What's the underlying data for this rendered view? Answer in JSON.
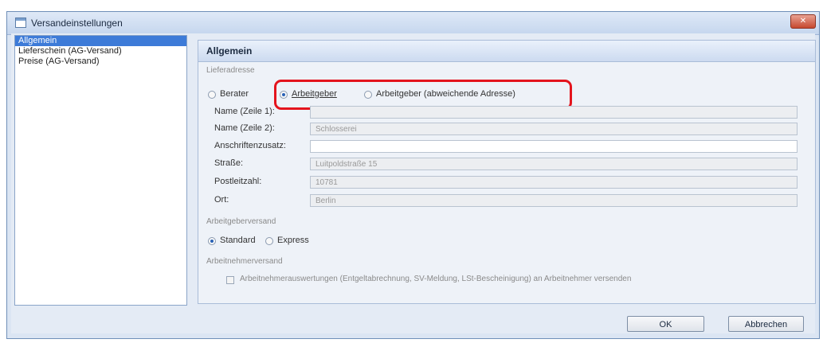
{
  "window": {
    "title": "Versandeinstellungen",
    "close_label": "✕"
  },
  "nav": {
    "items": [
      {
        "label": "Allgemein",
        "selected": true
      },
      {
        "label": "Lieferschein (AG-Versand)",
        "selected": false
      },
      {
        "label": "Preise (AG-Versand)",
        "selected": false
      }
    ]
  },
  "panel": {
    "title": "Allgemein",
    "lieferadresse": {
      "group_title": "Lieferadresse",
      "options": [
        {
          "label": "Berater",
          "checked": false
        },
        {
          "label": "Arbeitgeber",
          "checked": true
        },
        {
          "label": "Arbeitgeber (abweichende Adresse)",
          "checked": false
        }
      ]
    },
    "fields": [
      {
        "label": "Name (Zeile 1):",
        "value": ""
      },
      {
        "label": "Name (Zeile 2):",
        "value": "Schlosserei"
      },
      {
        "label": "Anschriftenzusatz:",
        "value": ""
      },
      {
        "label": "Straße:",
        "value": "Luitpoldstraße 15"
      },
      {
        "label": "Postleitzahl:",
        "value": "10781"
      },
      {
        "label": "Ort:",
        "value": "Berlin"
      }
    ],
    "arbeitgeberversand": {
      "group_title": "Arbeitgeberversand",
      "options": [
        {
          "label": "Standard",
          "checked": true
        },
        {
          "label": "Express",
          "checked": false
        }
      ]
    },
    "arbeitnehmerversand": {
      "group_title": "Arbeitnehmerversand",
      "checkbox_label": "Arbeitnehmerauswertungen (Entgeltabrechnung, SV-Meldung, LSt-Bescheinigung) an Arbeitnehmer versenden",
      "checked": false
    }
  },
  "footer": {
    "ok_label": "OK",
    "cancel_label": "Abbrechen"
  },
  "colors": {
    "highlight": "#e4141d",
    "selection": "#3d7bd8"
  }
}
